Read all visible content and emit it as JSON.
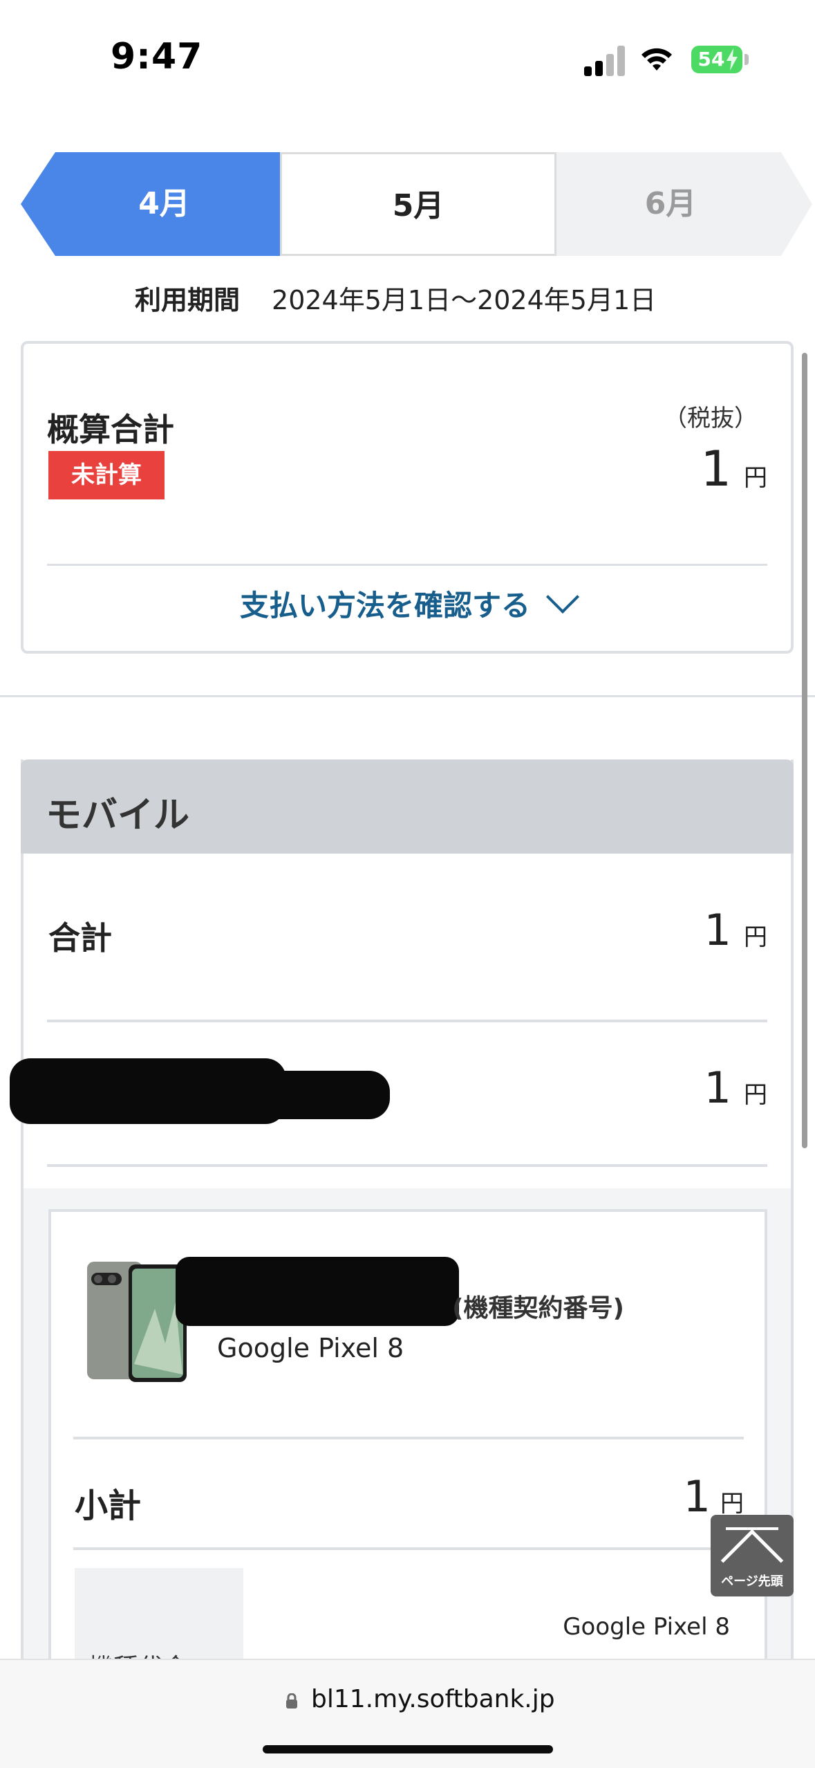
{
  "status_bar": {
    "time": "9:47",
    "battery": "54"
  },
  "tabs": {
    "prev": "4月",
    "current": "5月",
    "next": "6月"
  },
  "period": {
    "label": "利用期間",
    "value": "2024年5月1日〜2024年5月1日"
  },
  "summary": {
    "title": "概算合計",
    "badge": "未計算",
    "tax_note": "（税抜）",
    "amount": "1",
    "currency": "円",
    "payment_link": "支払い方法を確認する"
  },
  "mobile": {
    "title": "モバイル",
    "total_label": "合計",
    "total_amount": "1",
    "line_amount": "1",
    "currency": "円",
    "device": {
      "contract_suffix": "(機種契約番号)",
      "model": "Google Pixel 8",
      "subtotal_label": "小計",
      "subtotal_amount": "1",
      "detail_label": "機種代金",
      "detail_model": "Google Pixel 8"
    }
  },
  "page_top": {
    "label": "ページ先頭"
  },
  "browser": {
    "url": "bl11.my.softbank.jp"
  },
  "colors": {
    "accent": "#4a86e8",
    "badge": "#e8413e",
    "link": "#175e8c",
    "section_header": "#cfd3d7"
  }
}
